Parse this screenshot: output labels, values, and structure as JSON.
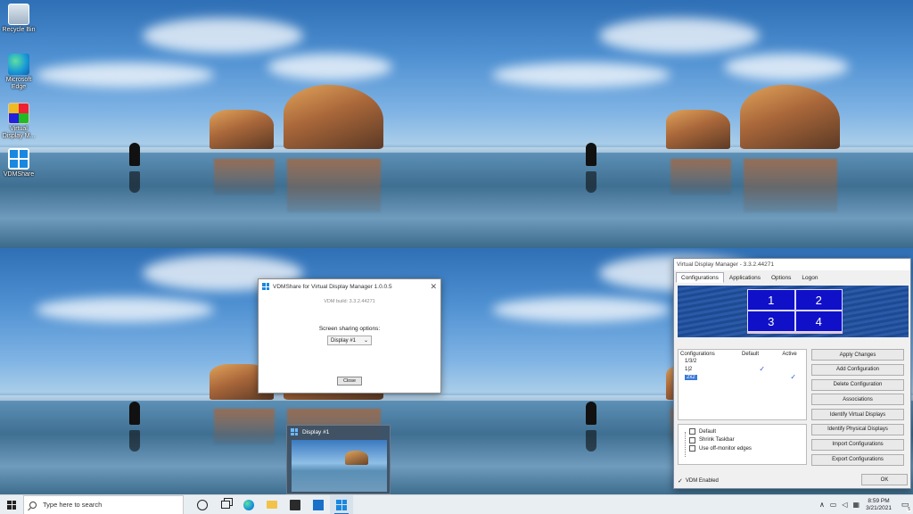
{
  "desktop_icons": [
    {
      "label": "Recycle Bin",
      "icon": "recycle-bin-icon"
    },
    {
      "label": "Microsoft Edge",
      "icon": "edge-icon"
    },
    {
      "label": "Virtual Display M...",
      "icon": "vdm-icon"
    },
    {
      "label": "VDMShare",
      "icon": "vdmshare-icon"
    }
  ],
  "vdmshare_dialog": {
    "title": "VDMShare for Virtual Display Manager 1.0.0.5",
    "build": "VDM build: 3.3.2.44271",
    "options_label": "Screen sharing options:",
    "selected_display": "Display #1",
    "close_label": "Close"
  },
  "preview": {
    "title": "Display #1"
  },
  "vdm_window": {
    "title": "Virtual Display Manager - 3.3.2.44271",
    "tabs": [
      "Configurations",
      "Applications",
      "Options",
      "Logon"
    ],
    "active_tab": "Configurations",
    "grid_cells": [
      "1",
      "2",
      "3",
      "4"
    ],
    "list_headers": [
      "Configurations",
      "Default",
      "Active"
    ],
    "configurations": [
      {
        "name": "1/3/2",
        "default": "",
        "active": ""
      },
      {
        "name": "1|2",
        "default": "✓",
        "active": ""
      },
      {
        "name": "2x2",
        "default": "",
        "active": "✓",
        "selected": true
      }
    ],
    "buttons": [
      "Apply Changes",
      "Add Configuration",
      "Delete Configuration",
      "Associations",
      "Identify Virtual Displays",
      "Identify Physical Displays",
      "Import Configurations",
      "Export Configurations"
    ],
    "options": [
      "Default",
      "Shrink Taskbar",
      "Use off-monitor edges"
    ],
    "vdm_enabled_label": "VDM Enabled",
    "ok_label": "OK"
  },
  "taskbar": {
    "search_placeholder": "Type here to search",
    "time": "8:59 PM",
    "date": "3/21/2021",
    "notification_count": "5"
  },
  "colors": {
    "accent": "#1a88e0",
    "grid_cell": "#1010c8",
    "banner": "#1e4a92"
  }
}
